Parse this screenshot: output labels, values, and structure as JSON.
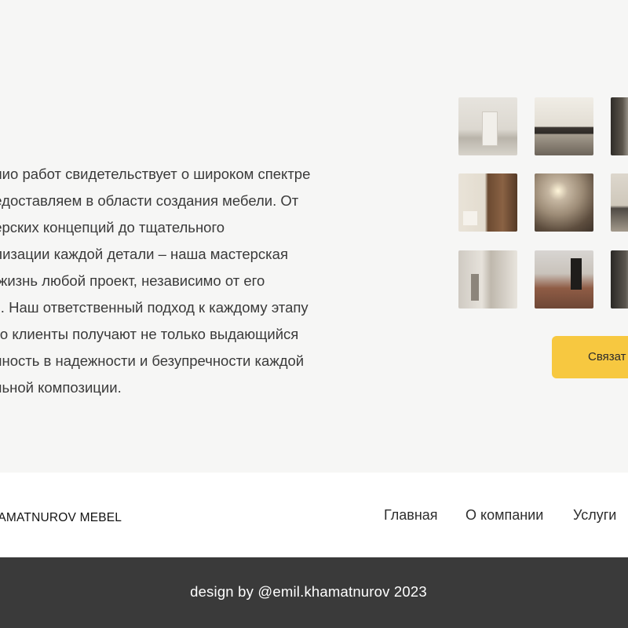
{
  "portfolio": {
    "description_lines": [
      "олио работ свидетельствует о широком спектре",
      "редоставляем в области создания мебели. От",
      "нерских концепций до тщательного",
      "ализации каждой детали – наша мастерская",
      "в жизнь любой проект, независимо от его",
      "ти. Наш ответственный подход к каждому этапу",
      "что клиенты получают не только выдающийся",
      "енность в надежности и безупречности каждой",
      "ельной композиции."
    ],
    "contact_button_label": "Связат"
  },
  "header": {
    "logo_text": "HAMATNUROV MEBEL",
    "nav": [
      "Главная",
      "О компании",
      "Услуги"
    ]
  },
  "footer": {
    "credit": "design by @emil.khamatnurov 2023"
  },
  "colors": {
    "accent": "#f7c840",
    "footer_bg": "#3a3a3a",
    "section_bg": "#f6f6f5"
  }
}
